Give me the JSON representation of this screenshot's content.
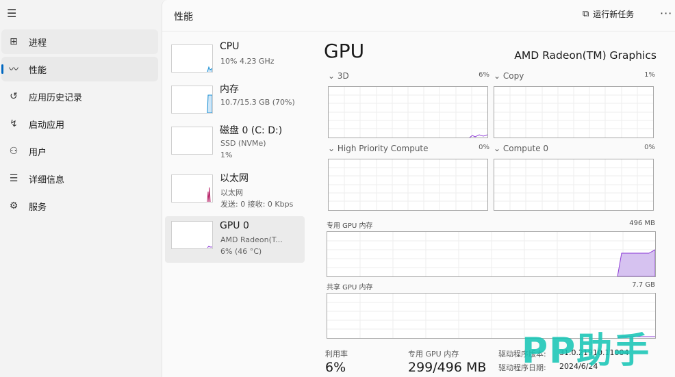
{
  "header": {
    "title": "性能",
    "run_task": "运行新任务",
    "more": "···"
  },
  "nav": {
    "items": [
      {
        "label": "进程",
        "icon": "processes-icon"
      },
      {
        "label": "性能",
        "icon": "performance-icon"
      },
      {
        "label": "应用历史记录",
        "icon": "history-icon"
      },
      {
        "label": "启动应用",
        "icon": "startup-icon"
      },
      {
        "label": "用户",
        "icon": "users-icon"
      },
      {
        "label": "详细信息",
        "icon": "details-icon"
      },
      {
        "label": "服务",
        "icon": "services-icon"
      }
    ]
  },
  "devices": [
    {
      "title": "CPU",
      "sub1": "10% 4.23 GHz",
      "sub2": "",
      "color": "#1a8fd3"
    },
    {
      "title": "内存",
      "sub1": "10.7/15.3 GB (70%)",
      "sub2": "",
      "color": "#1a8fd3"
    },
    {
      "title": "磁盘 0 (C: D:)",
      "sub1": "SSD (NVMe)",
      "sub2": "1%",
      "color": "#4c9a2a"
    },
    {
      "title": "以太网",
      "sub1": "以太网",
      "sub2": "发送: 0 接收: 0 Kbps",
      "color": "#b8256a"
    },
    {
      "title": "GPU 0",
      "sub1": "AMD Radeon(T...",
      "sub2": "6% (46 °C)",
      "color": "#8f3dd8"
    }
  ],
  "gpu": {
    "title": "GPU",
    "model": "AMD Radeon(TM) Graphics",
    "engines": [
      {
        "label": "3D",
        "pct": "6%"
      },
      {
        "label": "Copy",
        "pct": "1%"
      },
      {
        "label": "High Priority Compute",
        "pct": "0%"
      },
      {
        "label": "Compute 0",
        "pct": "0%"
      }
    ],
    "dedicated": {
      "label": "专用 GPU 内存",
      "value": "496 MB"
    },
    "shared": {
      "label": "共享 GPU 内存",
      "value": "7.7 GB"
    },
    "stats": {
      "util_label": "利用率",
      "util_value": "6%",
      "dedmem_label": "专用 GPU 内存",
      "dedmem_value": "299/496 MB",
      "driver_ver_label": "驱动程序版本:",
      "driver_ver_value": "31.0.21910.11004",
      "driver_date_label": "驱动程序日期:",
      "driver_date_value": "2024/6/24"
    }
  },
  "watermark": "PP助手",
  "colors": {
    "gpu": "#8f3dd8",
    "gpu_fill": "#d6c2f0",
    "accent": "#0067c0"
  }
}
